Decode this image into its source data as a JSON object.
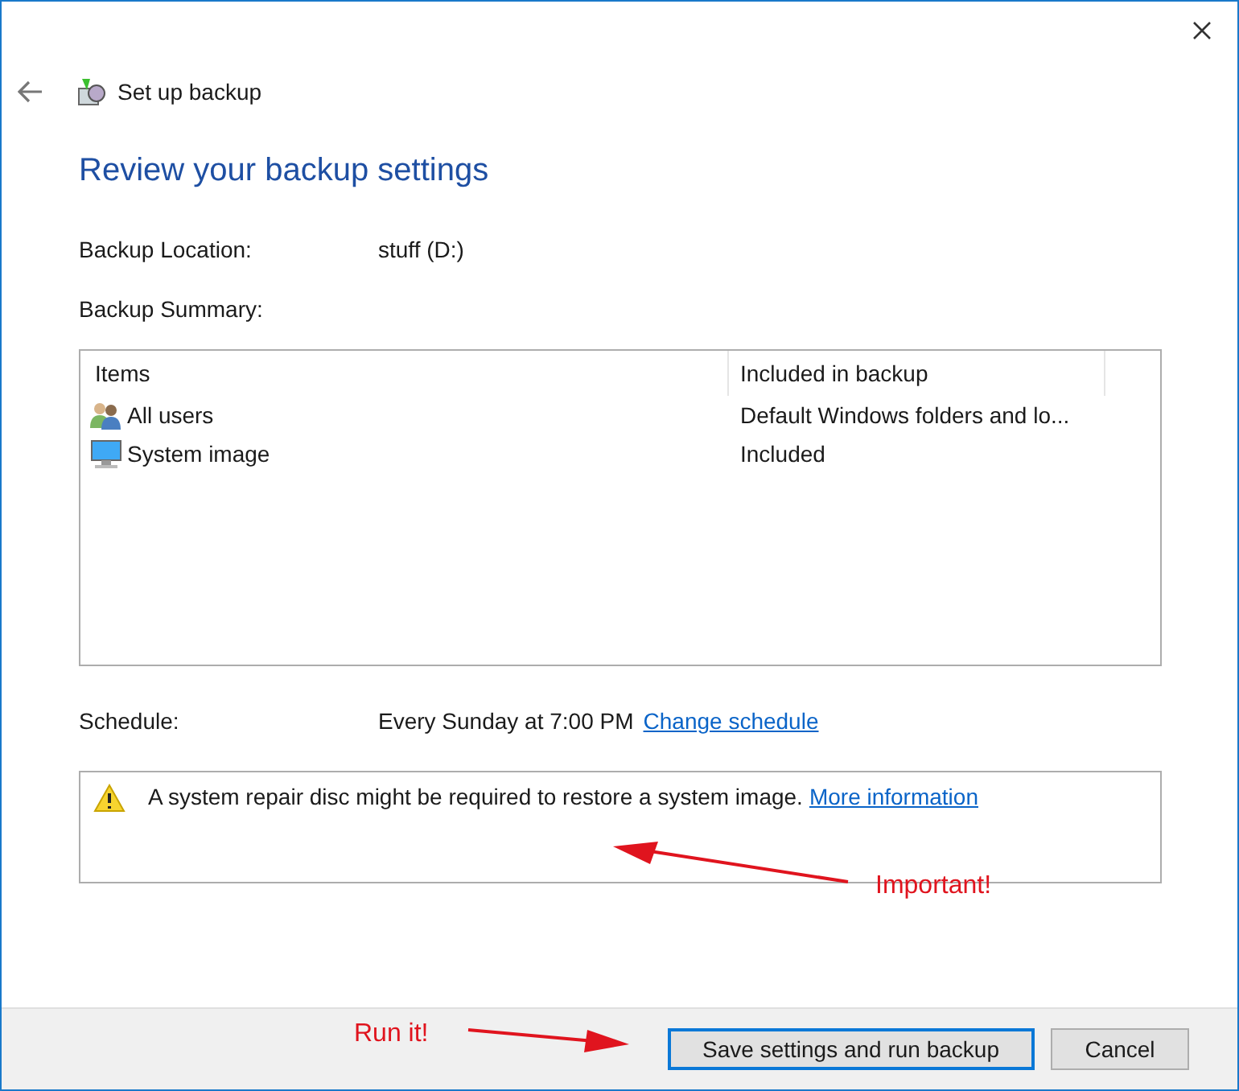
{
  "window": {
    "title": "Set up backup"
  },
  "heading": "Review your backup settings",
  "location": {
    "label": "Backup Location:",
    "value": "stuff (D:)"
  },
  "summary_label": "Backup Summary:",
  "table": {
    "columns": [
      "Items",
      "Included in backup"
    ],
    "rows": [
      {
        "kind": "users",
        "item": "All users",
        "included": "Default Windows folders and lo..."
      },
      {
        "kind": "computer",
        "item": "System image",
        "included": "Included"
      }
    ]
  },
  "schedule": {
    "label": "Schedule:",
    "value": "Every Sunday at 7:00 PM",
    "link": "Change schedule"
  },
  "notice": {
    "text": "A system repair disc might be required to restore a system image.",
    "link": "More information"
  },
  "annotations": [
    "Important!",
    "Run it!"
  ],
  "buttons": [
    {
      "label": "Save settings and run backup",
      "default": true
    },
    {
      "label": "Cancel",
      "default": false
    }
  ]
}
